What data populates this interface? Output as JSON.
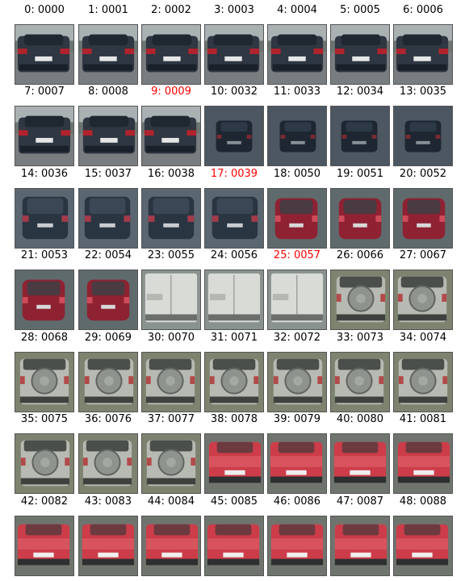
{
  "figure": {
    "thumbnails": [
      {
        "label": "0: 0000",
        "vehicle": "dark-sedan",
        "highlight": false
      },
      {
        "label": "1: 0001",
        "vehicle": "dark-sedan",
        "highlight": false
      },
      {
        "label": "2: 0002",
        "vehicle": "dark-sedan",
        "highlight": false
      },
      {
        "label": "3: 0003",
        "vehicle": "dark-sedan",
        "highlight": false
      },
      {
        "label": "4: 0004",
        "vehicle": "dark-sedan",
        "highlight": false
      },
      {
        "label": "5: 0005",
        "vehicle": "dark-sedan",
        "highlight": false
      },
      {
        "label": "6: 0006",
        "vehicle": "dark-sedan",
        "highlight": false
      },
      {
        "label": "7: 0007",
        "vehicle": "dark-sedan",
        "highlight": false
      },
      {
        "label": "8: 0008",
        "vehicle": "dark-sedan",
        "highlight": false
      },
      {
        "label": "9: 0009",
        "vehicle": "dark-sedan",
        "highlight": true
      },
      {
        "label": "10: 0032",
        "vehicle": "dark-small",
        "highlight": false
      },
      {
        "label": "11: 0033",
        "vehicle": "dark-small",
        "highlight": false
      },
      {
        "label": "12: 0034",
        "vehicle": "dark-small",
        "highlight": false
      },
      {
        "label": "13: 0035",
        "vehicle": "dark-small",
        "highlight": false
      },
      {
        "label": "14: 0036",
        "vehicle": "dark-hatch",
        "highlight": false
      },
      {
        "label": "15: 0037",
        "vehicle": "dark-hatch",
        "highlight": false
      },
      {
        "label": "16: 0038",
        "vehicle": "dark-hatch",
        "highlight": false
      },
      {
        "label": "17: 0039",
        "vehicle": "dark-hatch",
        "highlight": true
      },
      {
        "label": "18: 0050",
        "vehicle": "red-hatch",
        "highlight": false
      },
      {
        "label": "19: 0051",
        "vehicle": "red-hatch",
        "highlight": false
      },
      {
        "label": "20: 0052",
        "vehicle": "red-hatch",
        "highlight": false
      },
      {
        "label": "21: 0053",
        "vehicle": "red-hatch",
        "highlight": false
      },
      {
        "label": "22: 0054",
        "vehicle": "red-hatch",
        "highlight": false
      },
      {
        "label": "23: 0055",
        "vehicle": "white-van",
        "highlight": false
      },
      {
        "label": "24: 0056",
        "vehicle": "white-van",
        "highlight": false
      },
      {
        "label": "25: 0057",
        "vehicle": "white-van",
        "highlight": true
      },
      {
        "label": "26: 0066",
        "vehicle": "suv-spare",
        "highlight": false
      },
      {
        "label": "27: 0067",
        "vehicle": "suv-spare",
        "highlight": false
      },
      {
        "label": "28: 0068",
        "vehicle": "suv-spare",
        "highlight": false
      },
      {
        "label": "29: 0069",
        "vehicle": "suv-spare",
        "highlight": false
      },
      {
        "label": "30: 0070",
        "vehicle": "suv-spare",
        "highlight": false
      },
      {
        "label": "31: 0071",
        "vehicle": "suv-spare",
        "highlight": false
      },
      {
        "label": "32: 0072",
        "vehicle": "suv-spare",
        "highlight": false
      },
      {
        "label": "33: 0073",
        "vehicle": "suv-spare",
        "highlight": false
      },
      {
        "label": "34: 0074",
        "vehicle": "suv-spare",
        "highlight": false
      },
      {
        "label": "35: 0075",
        "vehicle": "suv-spare",
        "highlight": false
      },
      {
        "label": "36: 0076",
        "vehicle": "suv-spare",
        "highlight": false
      },
      {
        "label": "37: 0077",
        "vehicle": "suv-spare",
        "highlight": false
      },
      {
        "label": "38: 0078",
        "vehicle": "red-sedan",
        "highlight": false
      },
      {
        "label": "39: 0079",
        "vehicle": "red-sedan",
        "highlight": false
      },
      {
        "label": "40: 0080",
        "vehicle": "red-sedan",
        "highlight": false
      },
      {
        "label": "41: 0081",
        "vehicle": "red-sedan",
        "highlight": false
      },
      {
        "label": "42: 0082",
        "vehicle": "red-sedan",
        "highlight": false
      },
      {
        "label": "43: 0083",
        "vehicle": "red-sedan",
        "highlight": false
      },
      {
        "label": "44: 0084",
        "vehicle": "red-sedan",
        "highlight": false
      },
      {
        "label": "45: 0085",
        "vehicle": "red-sedan",
        "highlight": false
      },
      {
        "label": "46: 0086",
        "vehicle": "red-sedan",
        "highlight": false
      },
      {
        "label": "47: 0087",
        "vehicle": "red-sedan",
        "highlight": false
      },
      {
        "label": "48: 0088",
        "vehicle": "red-sedan",
        "highlight": false
      }
    ],
    "colors": {
      "label_normal": "#000000",
      "label_highlight": "#ff0000",
      "road": "#7a7d80",
      "sky": "#a9b1b3"
    }
  }
}
